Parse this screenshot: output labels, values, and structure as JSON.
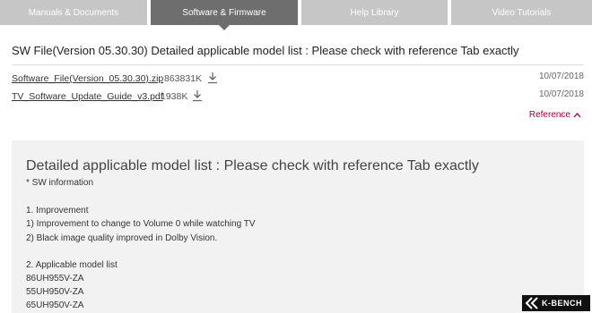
{
  "tabs": [
    {
      "label": "Manuals & Documents",
      "active": false
    },
    {
      "label": "Software & Firmware",
      "active": true
    },
    {
      "label": "Help Library",
      "active": false
    },
    {
      "label": "Video Tutorials",
      "active": false
    }
  ],
  "heading": "SW File(Version 05.30.30) Detailed applicable model list : Please check with reference Tab exactly",
  "files": [
    {
      "name": "Software_File(Version_05.30.30).zip",
      "size": "863831K",
      "date": "10/07/2018",
      "icon": "download-icon"
    },
    {
      "name": "TV_Software_Update_Guide_v3.pdf",
      "size": "1938K",
      "date": "10/07/2018",
      "icon": "download-icon"
    }
  ],
  "reference": {
    "label": "Reference",
    "icon": "chevron-up-icon"
  },
  "info": {
    "heading": "Detailed applicable model list : Please check with reference Tab exactly",
    "lines": [
      "* SW information",
      "1. Improvement",
      " 1) Improvement to change to Volume 0 while watching TV",
      " 2) Black image quality improved in Dolby Vision.",
      "2. Applicable model list",
      "86UH955V-ZA",
      "55UH950V-ZA",
      "65UH950V-ZA"
    ]
  },
  "watermark": {
    "text": "K-BENCH"
  },
  "colors": {
    "tab_inactive": "#c6c6c6",
    "tab_active": "#6e6e6e",
    "accent": "#a50034",
    "info_bg": "#f2f2f2"
  }
}
